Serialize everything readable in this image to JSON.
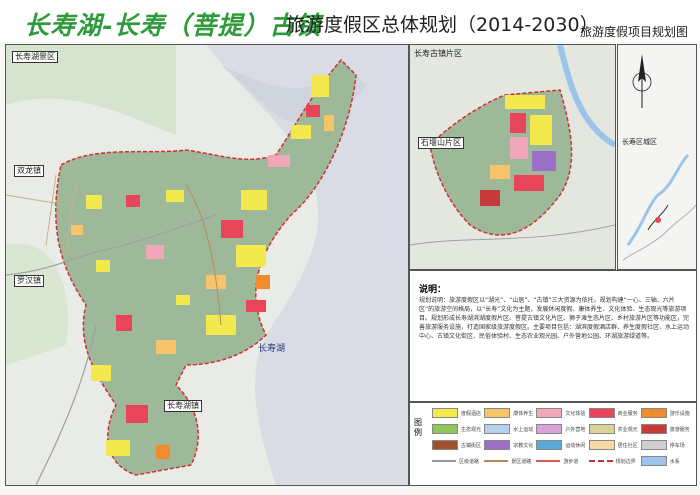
{
  "header": {
    "brand": "长寿湖-长寿（菩提）古镇",
    "title": "旅游度假区总体规划（2014-2030）",
    "subtitle": "旅游度假项目规划图"
  },
  "main_map": {
    "labels": {
      "tl": "长寿湖景区",
      "shuangfeng": "双龙镇",
      "luohan": "罗汉镇",
      "bottom_town": "长寿湖镇",
      "lake": "长寿湖"
    }
  },
  "inset_map": {
    "labels": {
      "top_left": "长寿古镇片区",
      "west": "石堰山片区"
    }
  },
  "region_map": {
    "labels": {
      "center": "长寿区城区"
    }
  },
  "notes": {
    "heading": "说明：",
    "body": "规划说明：旅游度假区以“湖光”、“山居”、“古镇”三大资源为依托，规划构建“一心、三轴、六片区”的旅游空间格局，以“长寿”文化为主题，发展休闲度假、康体养生、文化体验、生态观光等旅游项目。规划形成长寿湖滨湖度假片区、菩提古镇文化片区、狮子滩生态片区、乡村旅游片区等功能区，完善旅游服务设施，打造国家级旅游度假区。主要项目包括：湖滨度假酒店群、养生度假社区、水上运动中心、古镇文化街区、民俗体验村、生态农业观光园、户外营地公园、环湖旅游绿道等。"
  },
  "legend": {
    "title": "图例",
    "items": [
      {
        "label": "度假酒店",
        "color": "#f2e94e",
        "style": "fill"
      },
      {
        "label": "康体养生",
        "color": "#f7c46a",
        "style": "fill"
      },
      {
        "label": "文化体验",
        "color": "#f2a7b8",
        "style": "fill"
      },
      {
        "label": "商业服务",
        "color": "#e8455a",
        "style": "fill"
      },
      {
        "label": "游乐设施",
        "color": "#f08c2e",
        "style": "fill"
      },
      {
        "label": "生态观光",
        "color": "#8fc85a",
        "style": "fill"
      },
      {
        "label": "水上运动",
        "color": "#b8d0f0",
        "style": "fill"
      },
      {
        "label": "户外营地",
        "color": "#d7a3d9",
        "style": "fill"
      },
      {
        "label": "农业观光",
        "color": "#dcd39a",
        "style": "fill"
      },
      {
        "label": "旅游服务",
        "color": "#c83a3a",
        "style": "fill"
      },
      {
        "label": "古镇街区",
        "color": "#a0522d",
        "style": "fill"
      },
      {
        "label": "宗教文化",
        "color": "#9a6fc4",
        "style": "fill"
      },
      {
        "label": "运动休闲",
        "color": "#5aa8d8",
        "style": "fill"
      },
      {
        "label": "居住社区",
        "color": "#f5d9a6",
        "style": "fill"
      },
      {
        "label": "停车场",
        "color": "#cfcfcf",
        "style": "fill"
      },
      {
        "label": "区级道路",
        "color": "#999999",
        "style": "line"
      },
      {
        "label": "景区道路",
        "color": "#b88a5a",
        "style": "line"
      },
      {
        "label": "游步道",
        "color": "#d85a5a",
        "style": "line"
      },
      {
        "label": "规划边界",
        "color": "#d03030",
        "style": "dash"
      },
      {
        "label": "水系",
        "color": "#9bc4e8",
        "style": "fill"
      }
    ]
  },
  "colors": {
    "brand": "#2e9a3a",
    "forest": "#9eb89a",
    "lake": "#d9dce4",
    "boundary": "#d03030"
  }
}
